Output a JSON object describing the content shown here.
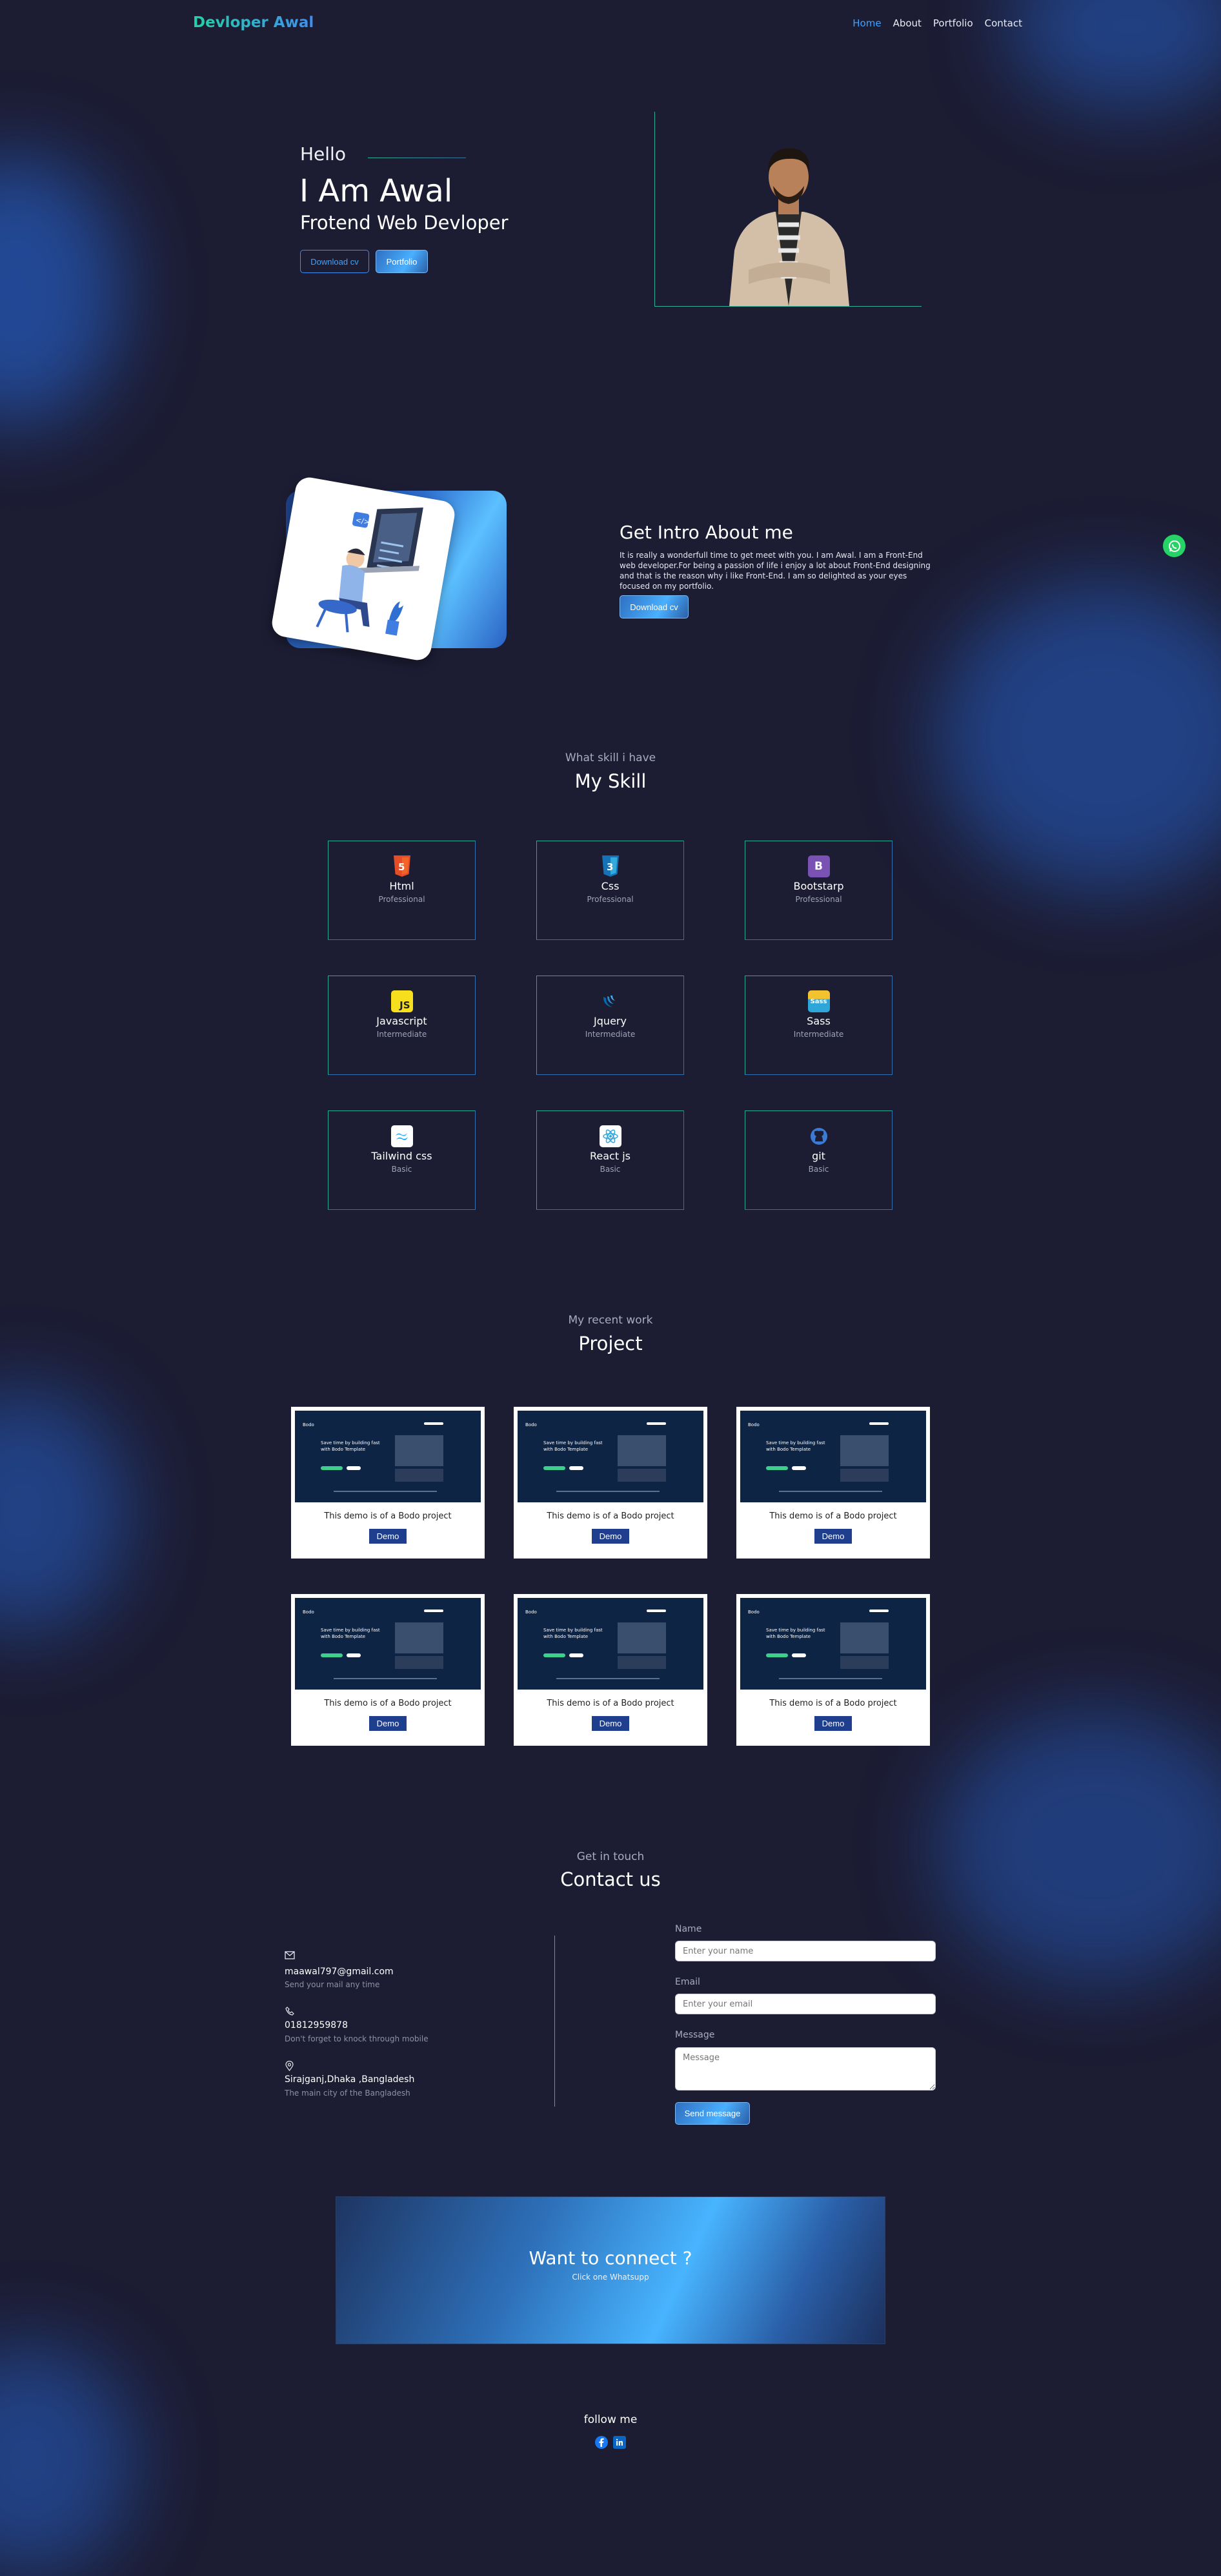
{
  "colors": {
    "bg": "#1c1c33",
    "accent_teal": "#26d1a5",
    "accent_blue": "#3e8ef0",
    "whatsapp": "#25d366"
  },
  "nav": {
    "brand": "Devloper Awal",
    "links": [
      {
        "label": "Home",
        "active": true
      },
      {
        "label": "About"
      },
      {
        "label": "Portfolio"
      },
      {
        "label": "Contact"
      }
    ]
  },
  "hero": {
    "greeting": "Hello",
    "name": "I Am Awal",
    "role": "Frotend Web Devloper",
    "download_label": "Download cv",
    "portfolio_label": "Portfolio"
  },
  "about": {
    "title": "Get Intro About me",
    "text": "It is really a wonderfull time to get meet with you. I am Awal. I am a Front-End web developer.For being a passion of life i enjoy a lot about Front-End designing and that is the reason why i like Front-End. I am so delighted as your eyes focused on my portfolio.",
    "download_label": "Download cv"
  },
  "skills": {
    "subtitle": "What skill i have",
    "title": "My Skill",
    "items": [
      {
        "name": "Html",
        "level": "Professional",
        "icon": "html5-icon"
      },
      {
        "name": "Css",
        "level": "Professional",
        "icon": "css3-icon"
      },
      {
        "name": "Bootstarp",
        "level": "Professional",
        "icon": "bootstrap-icon"
      },
      {
        "name": "Javascript",
        "level": "Intermediate",
        "icon": "javascript-icon"
      },
      {
        "name": "Jquery",
        "level": "Intermediate",
        "icon": "jquery-icon"
      },
      {
        "name": "Sass",
        "level": "Intermediate",
        "icon": "sass-icon"
      },
      {
        "name": "Tailwind css",
        "level": "Basic",
        "icon": "tailwind-icon"
      },
      {
        "name": "React js",
        "level": "Basic",
        "icon": "react-icon"
      },
      {
        "name": "git",
        "level": "Basic",
        "icon": "github-icon"
      }
    ]
  },
  "projects": {
    "subtitle": "My recent work",
    "title": "Project",
    "items": [
      {
        "caption": "This demo is of a Bodo project",
        "button": "Demo"
      },
      {
        "caption": "This demo is of a Bodo project",
        "button": "Demo"
      },
      {
        "caption": "This demo is of a Bodo project",
        "button": "Demo"
      },
      {
        "caption": "This demo is of a Bodo project",
        "button": "Demo"
      },
      {
        "caption": "This demo is of a Bodo project",
        "button": "Demo"
      },
      {
        "caption": "This demo is of a Bodo project",
        "button": "Demo"
      }
    ],
    "screenshot": {
      "logo": "Bodo",
      "headline_1": "Save time by building fast",
      "headline_2": "with Bodo Template"
    }
  },
  "contact": {
    "subtitle": "Get in touch",
    "title": "Contact us",
    "email": {
      "value": "maawal797@gmail.com",
      "note": "Send your mail any time"
    },
    "phone": {
      "value": "01812959878",
      "note": "Don't forget to knock through mobile"
    },
    "address": {
      "value": "Sirajganj,Dhaka ,Bangladesh",
      "note": "The main city of the Bangladesh"
    },
    "form": {
      "name_label": "Name",
      "name_placeholder": "Enter your name",
      "email_label": "Email",
      "email_placeholder": "Enter your email",
      "message_label": "Message",
      "message_placeholder": "Message",
      "submit_label": "Send message"
    }
  },
  "cta": {
    "title": "Want to connect ?",
    "subtitle": "Click one Whatsupp"
  },
  "footer": {
    "title": "follow me"
  }
}
